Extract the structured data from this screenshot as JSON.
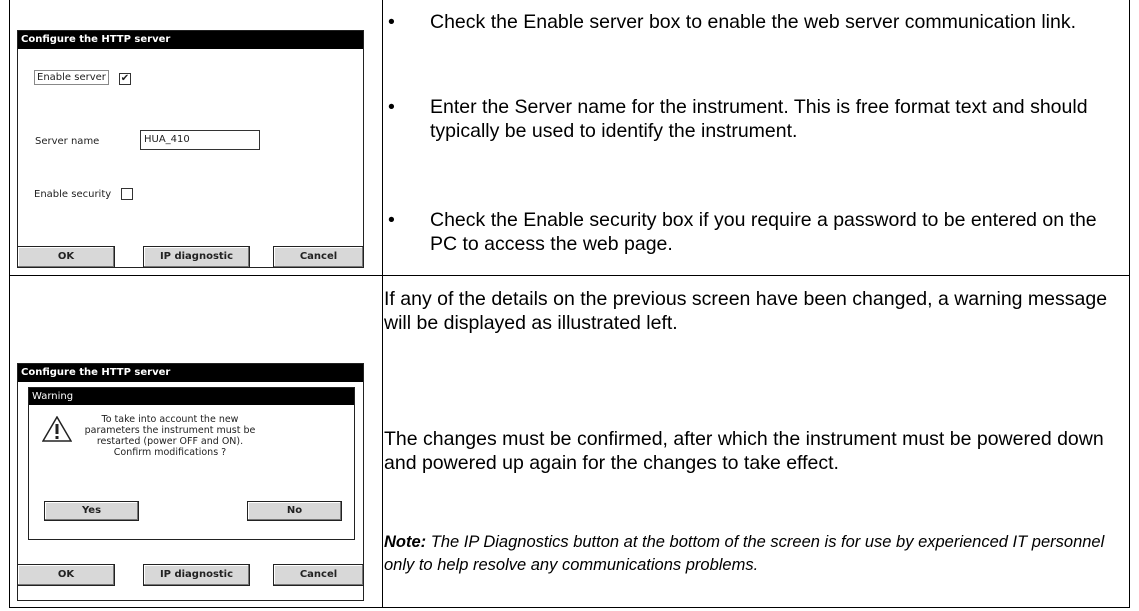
{
  "screen1": {
    "title": "Configure the HTTP server",
    "enable_server_label": "Enable server",
    "enable_server_checked": "✔",
    "server_name_label": "Server name",
    "server_name_value": "HUA_410",
    "enable_security_label": "Enable security",
    "ok_label": "OK",
    "ip_diag_label": "IP diagnostic",
    "cancel_label": "Cancel"
  },
  "screen2": {
    "title": "Configure the HTTP server",
    "dialog_title": "Warning",
    "dialog_lines": [
      "To take into account the new",
      "parameters the instrument must be",
      "restarted (power OFF and ON).",
      "Confirm modifications ?"
    ],
    "yes_label": "Yes",
    "no_label": "No",
    "ok_label": "OK",
    "ip_diag_label": "IP diagnostic",
    "cancel_label": "Cancel"
  },
  "bullets": [
    "Check the Enable server box to enable the web server communication link.",
    "Enter the Server name for the instrument. This is free format text and should typically be used to identify the instrument.",
    "Check the Enable security box if you require a password to be entered on the PC to access the web page."
  ],
  "bullet_symbol": "•",
  "para1": "If any of the details on the previous screen have been changed, a warning message will be displayed as illustrated left.",
  "para2": "The changes must be confirmed, after which the instrument must be powered down and powered up again for the changes to take effect.",
  "note_label": "Note:",
  "note_text": " The IP Diagnostics button at the bottom of the screen is for use by experienced IT personnel only to help resolve any communications problems."
}
